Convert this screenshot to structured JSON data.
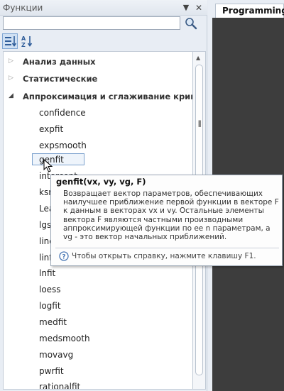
{
  "panel": {
    "title": "Функции",
    "pin_glyph": "▼ ✕",
    "search": {
      "value": "",
      "placeholder": ""
    }
  },
  "tree": {
    "categories": [
      {
        "label": "Анализ данных",
        "expanded": false
      },
      {
        "label": "Статистические",
        "expanded": false
      },
      {
        "label": "Аппроксимация и сглаживание кривых",
        "expanded": true
      }
    ],
    "functions": [
      "confidence",
      "expfit",
      "expsmooth",
      "genfit",
      "intercept",
      "ksmooth",
      "Leasfit",
      "lgsfit",
      "line",
      "linfit",
      "lnfit",
      "loess",
      "logfit",
      "medfit",
      "medsmooth",
      "movavg",
      "pwrfit",
      "rationalfit"
    ],
    "selected": "genfit"
  },
  "right": {
    "tab_label": "Programming"
  },
  "tooltip": {
    "title": "genfit(vx, vy, vg, F)",
    "description": "Возвращает вектор параметров, обеспечивающих наилучшее приближение первой функции в векторе F к данным в векторах vx и vy. Остальные элементы вектора F являются частными производными аппроксимирующей функции по ее n параметрам, а vg - это вектор начальных приближений.",
    "help": "Чтобы открыть справку, нажмите клавишу F1."
  },
  "colors": {
    "accent": "#4a78b5",
    "doc_area": "#3d3d3d"
  }
}
